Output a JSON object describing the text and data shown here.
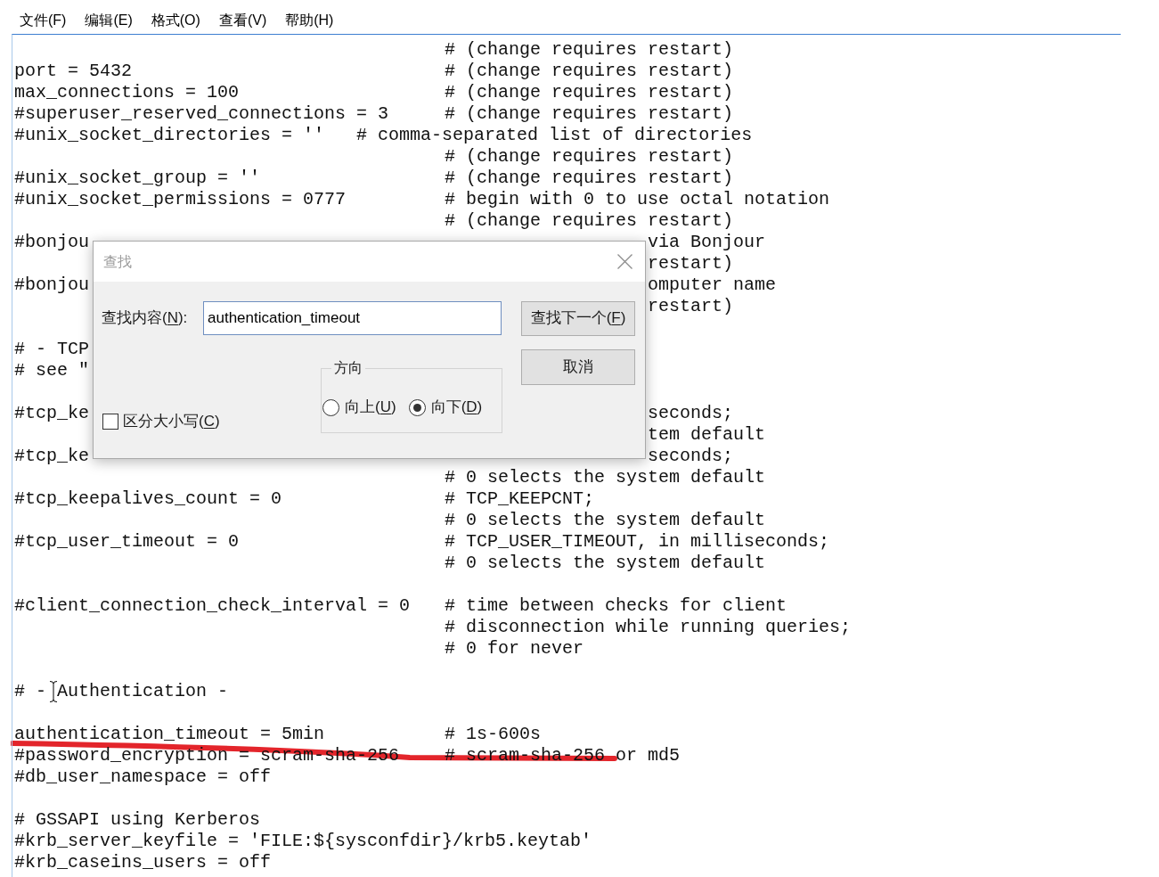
{
  "menu": [
    "文件(F)",
    "编辑(E)",
    "格式(O)",
    "查看(V)",
    "帮助(H)"
  ],
  "editor": {
    "lines": [
      {
        "kind": "code",
        "comment": "# (change requires restart)"
      },
      {
        "kind": "code",
        "code": "port = 5432",
        "comment": "# (change requires restart)"
      },
      {
        "kind": "code",
        "code": "max_connections = 100",
        "comment": "# (change requires restart)"
      },
      {
        "kind": "code",
        "code": "#superuser_reserved_connections = 3",
        "comment": "# (change requires restart)"
      },
      {
        "kind": "code",
        "code": "#unix_socket_directories = ''   # comma-separated list of directories"
      },
      {
        "kind": "code",
        "comment": "# (change requires restart)"
      },
      {
        "kind": "code",
        "code": "#unix_socket_group = ''",
        "comment": "# (change requires restart)"
      },
      {
        "kind": "code",
        "code": "#unix_socket_permissions = 0777",
        "comment": "# begin with 0 to use octal notation"
      },
      {
        "kind": "code",
        "comment": "# (change requires restart)"
      },
      {
        "kind": "covered",
        "left": "#bonjou",
        "right": "via Bonjour"
      },
      {
        "kind": "covered",
        "right": "restart)"
      },
      {
        "kind": "covered",
        "left": "#bonjou",
        "right": "omputer name"
      },
      {
        "kind": "covered",
        "right": "restart)"
      },
      {
        "kind": "blank"
      },
      {
        "kind": "covered",
        "left": "# - TCP"
      },
      {
        "kind": "covered",
        "left": "# see \""
      },
      {
        "kind": "blank"
      },
      {
        "kind": "covered",
        "left": "#tcp_ke",
        "right": "seconds;"
      },
      {
        "kind": "covered",
        "right": "tem default"
      },
      {
        "kind": "covered",
        "left": "#tcp_ke",
        "right": "seconds;"
      },
      {
        "kind": "code",
        "comment": "# 0 selects the system default"
      },
      {
        "kind": "code",
        "code": "#tcp_keepalives_count = 0",
        "comment": "# TCP_KEEPCNT;"
      },
      {
        "kind": "code",
        "comment": "# 0 selects the system default"
      },
      {
        "kind": "code",
        "code": "#tcp_user_timeout = 0",
        "comment": "# TCP_USER_TIMEOUT, in milliseconds;"
      },
      {
        "kind": "code",
        "comment": "# 0 selects the system default"
      },
      {
        "kind": "blank"
      },
      {
        "kind": "code",
        "code": "#client_connection_check_interval = 0",
        "comment": "# time between checks for client"
      },
      {
        "kind": "code",
        "comment": "# disconnection while running queries;"
      },
      {
        "kind": "code",
        "comment": "# 0 for never"
      },
      {
        "kind": "blank"
      },
      {
        "kind": "pointer",
        "before": "# -",
        "after": "Authentication -"
      },
      {
        "kind": "blank"
      },
      {
        "kind": "code",
        "code": "authentication_timeout = 5min",
        "comment": "# 1s-600s"
      },
      {
        "kind": "code",
        "code": "#password_encryption = scram-sha-256",
        "comment": "# scram-sha-256 or md5"
      },
      {
        "kind": "code",
        "code": "#db_user_namespace = off"
      },
      {
        "kind": "blank"
      },
      {
        "kind": "code",
        "code": "# GSSAPI using Kerberos"
      },
      {
        "kind": "code",
        "code": "#krb_server_keyfile = 'FILE:${sysconfdir}/krb5.keytab'"
      },
      {
        "kind": "code",
        "code": "#krb_caseins_users = off"
      }
    ]
  },
  "find_dialog": {
    "title": "查找",
    "find_what": {
      "label": [
        "查找内容(",
        "N",
        "):"
      ],
      "value": "authentication_timeout"
    },
    "buttons": [
      {
        "label": [
          "查找下一个(",
          "F",
          ")"
        ]
      },
      {
        "label": [
          "取消"
        ]
      }
    ],
    "match_case": {
      "label": [
        "区分大小写(",
        "C",
        ")"
      ],
      "checked": false
    },
    "direction": {
      "title": "方向",
      "options": [
        {
          "label": [
            "向上(",
            "U",
            ")"
          ],
          "selected": false
        },
        {
          "label": [
            "向下(",
            "D",
            ")"
          ],
          "selected": true
        }
      ]
    }
  }
}
